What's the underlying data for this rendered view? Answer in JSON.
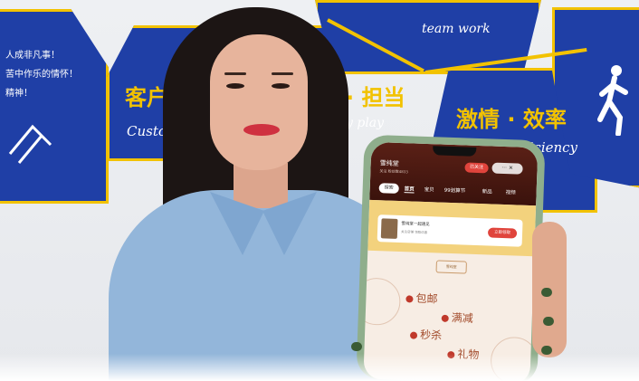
{
  "wall": {
    "slogan_line1": "人成非凡事！",
    "slogan_line2": "苦中作乐的情怀！",
    "slogan_line3": "精神！",
    "teamwork_script": "team work",
    "customer_cn": "客户 ·",
    "customer_en": "Custom",
    "duty_cn": "· 担当",
    "duty_en": "y play",
    "passion_cn": "激情 · 效率",
    "efficiency_en": "fficiency"
  },
  "phone": {
    "shop_name": "雪纯堂",
    "shop_sub": "关注 粉丝数4833",
    "follow_label": "已关注",
    "more_label": "··· ✕",
    "search_label": "搜索",
    "tabs": [
      "首页",
      "宝贝",
      "99划算节",
      "新品",
      "视频"
    ],
    "promo_title": "雪纯堂一起遇见",
    "promo_desc": "关注店铺 领取优惠",
    "promo_button": "立即领取",
    "banner_logo": "雪纯堂",
    "features": [
      "包邮",
      "满减",
      "秒杀",
      "礼物"
    ]
  }
}
